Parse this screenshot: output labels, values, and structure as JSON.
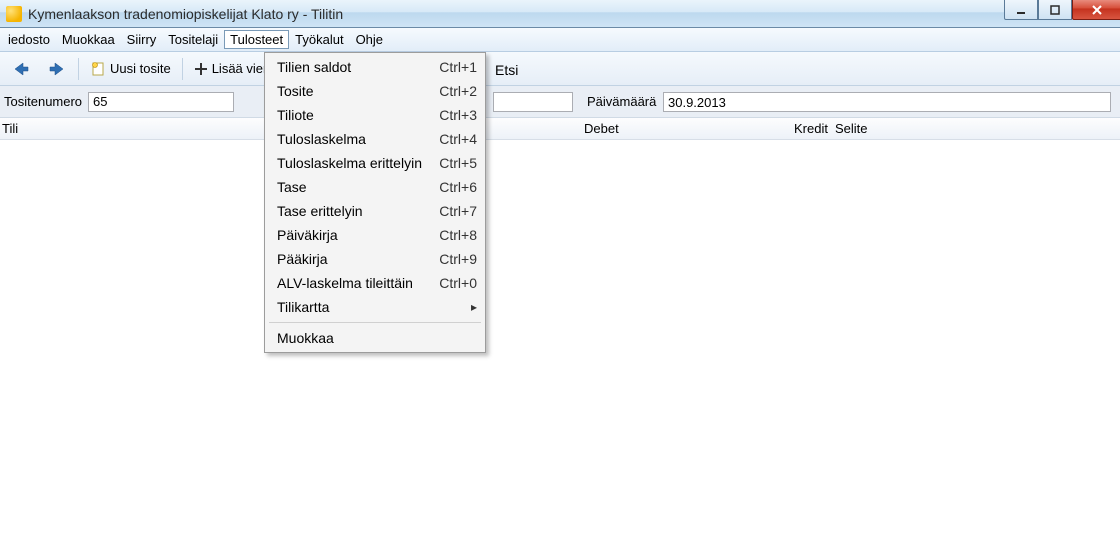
{
  "window": {
    "title": "Kymenlaakson tradenomiopiskelijat Klato ry - Tilitin"
  },
  "menu": {
    "items": [
      "iedosto",
      "Muokkaa",
      "Siirry",
      "Tositelaji",
      "Tulosteet",
      "Työkalut",
      "Ohje"
    ],
    "open_index": 4
  },
  "toolbar": {
    "new_voucher": "Uusi tosite",
    "add_entry": "Lisää vien",
    "search_label": "Etsi"
  },
  "fields": {
    "voucher_number_label": "Tositenumero",
    "voucher_number_value": "65",
    "date_label": "Päivämäärä",
    "date_value": "30.9.2013"
  },
  "columns": {
    "account": "Tili",
    "debit": "Debet",
    "credit": "Kredit",
    "description": "Selite"
  },
  "dropdown": {
    "items": [
      {
        "label": "Tilien saldot",
        "shortcut": "Ctrl+1"
      },
      {
        "label": "Tosite",
        "shortcut": "Ctrl+2"
      },
      {
        "label": "Tiliote",
        "shortcut": "Ctrl+3"
      },
      {
        "label": "Tuloslaskelma",
        "shortcut": "Ctrl+4"
      },
      {
        "label": "Tuloslaskelma erittelyin",
        "shortcut": "Ctrl+5"
      },
      {
        "label": "Tase",
        "shortcut": "Ctrl+6"
      },
      {
        "label": "Tase erittelyin",
        "shortcut": "Ctrl+7"
      },
      {
        "label": "Päiväkirja",
        "shortcut": "Ctrl+8"
      },
      {
        "label": "Pääkirja",
        "shortcut": "Ctrl+9"
      },
      {
        "label": "ALV-laskelma tileittäin",
        "shortcut": "Ctrl+0"
      },
      {
        "label": "Tilikartta",
        "submenu": true
      }
    ],
    "footer": "Muokkaa"
  }
}
